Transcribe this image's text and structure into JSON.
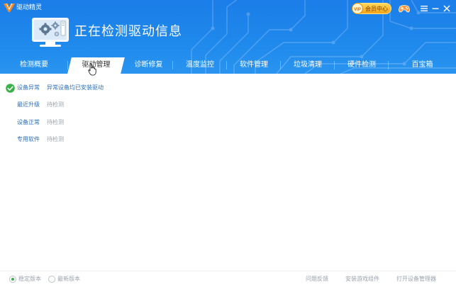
{
  "app": {
    "title": "驱动精灵"
  },
  "title_bar": {
    "vip_label": "会员中心",
    "icons": [
      "logo-icon",
      "vip-crown-icon",
      "game-controller-icon",
      "menu-icon",
      "minimize-icon",
      "close-icon"
    ]
  },
  "header": {
    "status_title": "正在检测驱动信息",
    "illustration": "monitor-gears-icon"
  },
  "tabs": [
    {
      "label": "检测概要"
    },
    {
      "label": "驱动管理"
    },
    {
      "label": "诊断修复"
    },
    {
      "label": "温度监控"
    },
    {
      "label": "软件管理"
    },
    {
      "label": "垃圾清理"
    },
    {
      "label": "硬件检测"
    },
    {
      "label": "百宝箱"
    }
  ],
  "active_tab": "驱动管理",
  "content": {
    "rows": [
      {
        "name": "设备异常",
        "desc": "异常设备均已安装驱动",
        "icon": "green-check-icon"
      },
      {
        "name": "最近升级",
        "desc": "待检测"
      },
      {
        "name": "设备正常",
        "desc": "待检测"
      },
      {
        "name": "专用软件",
        "desc": "待检测"
      }
    ]
  },
  "footer": {
    "version_options": [
      {
        "label": "稳定版本",
        "checked": true
      },
      {
        "label": "最新版本",
        "checked": false
      }
    ],
    "links": [
      {
        "label": "问题反馈"
      },
      {
        "label": "安装游戏组件"
      },
      {
        "label": "打开设备管理器"
      }
    ]
  },
  "colors": {
    "header_blue": "#1e88ec",
    "link_blue": "#2a6fc0",
    "muted_gray": "#9aa3ad",
    "check_green": "#3cb14a",
    "vip_gold": "#f4a417"
  }
}
